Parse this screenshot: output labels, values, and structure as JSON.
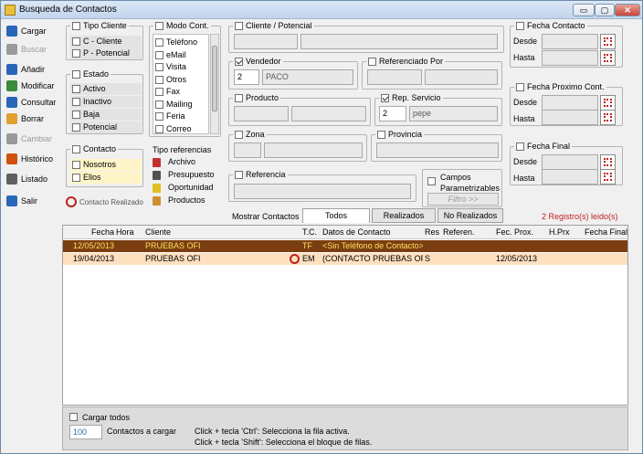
{
  "window": {
    "title": "Busqueda de Contactos",
    "min": "▭",
    "max": "▢",
    "close": "✕"
  },
  "toolbar": [
    {
      "label": "Cargar",
      "icon": "load-icon",
      "color": "#2a66b8",
      "disabled": false
    },
    {
      "label": "Buscar",
      "icon": "search-icon",
      "color": "#9a9a9a",
      "disabled": true
    },
    {
      "label": "Añadir",
      "icon": "add-icon",
      "color": "#2a66b8",
      "disabled": false
    },
    {
      "label": "Modificar",
      "icon": "edit-icon",
      "color": "#3a8a3a",
      "disabled": false
    },
    {
      "label": "Consultar",
      "icon": "view-icon",
      "color": "#2a66b8",
      "disabled": false
    },
    {
      "label": "Borrar",
      "icon": "eraser-icon",
      "color": "#e0a030",
      "disabled": false
    },
    {
      "label": "Cambiar",
      "icon": "swap-icon",
      "color": "#9a9a9a",
      "disabled": true
    },
    {
      "label": "Histórico",
      "icon": "history-icon",
      "color": "#d05010",
      "disabled": false
    },
    {
      "label": "Listado",
      "icon": "print-icon",
      "color": "#606060",
      "disabled": false
    },
    {
      "label": "Salir",
      "icon": "exit-icon",
      "color": "#2a66b8",
      "disabled": false
    }
  ],
  "tipo_cliente": {
    "title": "Tipo Cliente",
    "items": [
      "C - Cliente",
      "P - Potencial"
    ]
  },
  "estado": {
    "title": "Estado",
    "items": [
      "Activo",
      "Inactivo",
      "Baja",
      "Potencial"
    ]
  },
  "contacto": {
    "title": "Contacto",
    "items": [
      "Nosotros",
      "Ellos"
    ]
  },
  "contacto_realizado": "Contacto Realizado",
  "modo_cont": {
    "title": "Modo Cont.",
    "items": [
      "Teléfono",
      "eMail",
      "Visita",
      "Otros",
      "Fax",
      "Mailing",
      "Feria",
      "Correo"
    ]
  },
  "tipo_ref": {
    "title": "Tipo referencias",
    "items": [
      "Archivo",
      "Presupuesto",
      "Oportunidad",
      "Productos"
    ]
  },
  "cliente_potencial": {
    "title": "Cliente / Potencial"
  },
  "vendedor": {
    "title": "Vendedor",
    "code": "2",
    "name": "PACO"
  },
  "referenciado": {
    "title": "Referenciado Por"
  },
  "producto": {
    "title": "Producto"
  },
  "rep_servicio": {
    "title": "Rep. Servicio",
    "code": "2",
    "name": "pepe"
  },
  "zona": {
    "title": "Zona"
  },
  "provincia": {
    "title": "Provincia"
  },
  "referencia": {
    "title": "Referencia"
  },
  "campos": {
    "title": "Campos Parametrizables",
    "filtro": "Filtro >>"
  },
  "fecha_contacto": {
    "title": "Fecha Contacto",
    "desde": "Desde",
    "hasta": "Hasta"
  },
  "fecha_prox": {
    "title": "Fecha Proximo Cont.",
    "desde": "Desde",
    "hasta": "Hasta"
  },
  "fecha_final": {
    "title": "Fecha Final",
    "desde": "Desde",
    "hasta": "Hasta"
  },
  "mostrar": {
    "label": "Mostrar Contactos",
    "tabs": [
      "Todos",
      "Realizados",
      "No Realizados"
    ]
  },
  "registros": "2 Registro(s) leido(s)",
  "grid": {
    "headers": [
      "Fecha",
      "Hora",
      "Cliente",
      "T.C.",
      "Datos de Contacto",
      "Res",
      "Referen.",
      "Fec. Prox.",
      "H.Prx",
      "Fecha Final"
    ],
    "rows": [
      [
        "12/05/2013",
        "",
        "PRUEBAS OFI",
        "TF",
        "<Sin Teléfono de Contacto>",
        "",
        "",
        "",
        "",
        ""
      ],
      [
        "19/04/2013",
        "",
        "PRUEBAS OFI",
        "EM",
        "(CONTACTO PRUEBAS OFI",
        "S",
        "",
        "12/05/2013",
        "",
        ""
      ]
    ]
  },
  "bottom": {
    "cargar_todos": "Cargar todos",
    "cantidad": "100",
    "contactos_label": "Contactos a cargar",
    "hint1": "Click + tecla 'Ctrl': Selecciona la fila activa.",
    "hint2": "Click + tecla 'Shift': Selecciona el bloque de filas."
  },
  "colors": {
    "row_selected": "#7a3e10",
    "row_alt": "#fde0c0",
    "contacto_bg": "#fff5c8",
    "link_red": "#c02020"
  }
}
